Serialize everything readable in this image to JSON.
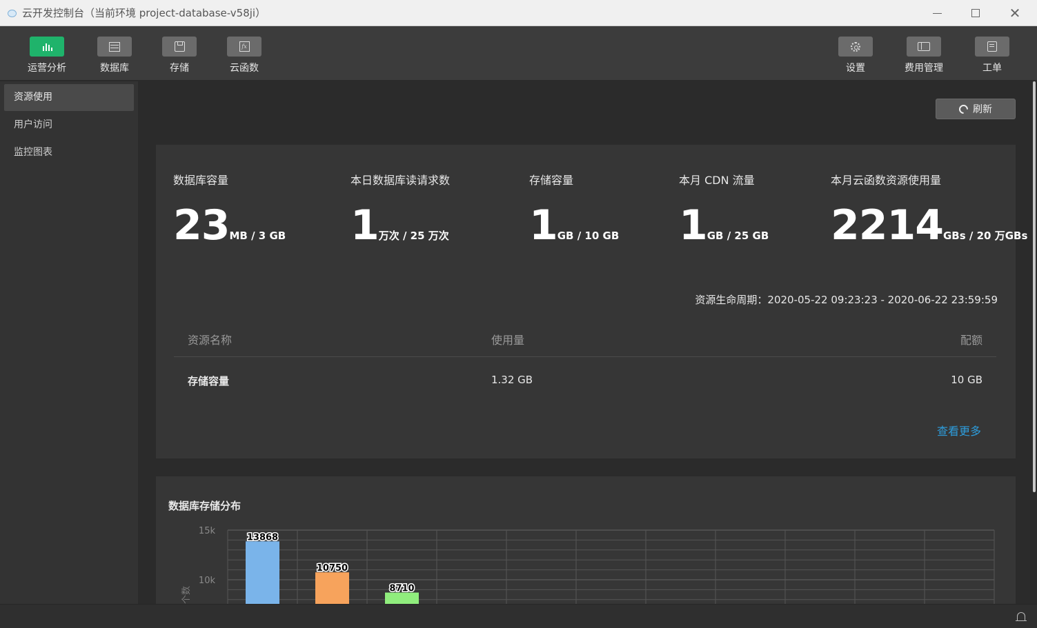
{
  "window": {
    "title": "云开发控制台（当前环境 project-database-v58ji）"
  },
  "toolbar": {
    "left": [
      {
        "label": "运营分析",
        "icon": "bar-chart-icon"
      },
      {
        "label": "数据库",
        "icon": "database-icon"
      },
      {
        "label": "存储",
        "icon": "storage-icon"
      },
      {
        "label": "云函数",
        "icon": "function-icon"
      }
    ],
    "right": [
      {
        "label": "设置",
        "icon": "gear-icon"
      },
      {
        "label": "费用管理",
        "icon": "billing-icon"
      },
      {
        "label": "工单",
        "icon": "ticket-icon"
      }
    ],
    "accent": "#1fb36b"
  },
  "sidebar": {
    "items": [
      {
        "label": "资源使用"
      },
      {
        "label": "用户访问"
      },
      {
        "label": "监控图表"
      }
    ]
  },
  "refresh_label": "刷新",
  "metrics": [
    {
      "label": "数据库容量",
      "value": "23",
      "unit": "MB / 3 GB"
    },
    {
      "label": "本日数据库读请求数",
      "value": "1",
      "unit": "万次 / 25 万次"
    },
    {
      "label": "存储容量",
      "value": "1",
      "unit": "GB / 10 GB"
    },
    {
      "label": "本月 CDN 流量",
      "value": "1",
      "unit": "GB / 25 GB"
    },
    {
      "label": "本月云函数资源使用量",
      "value": "2214",
      "unit": "GBs / 20 万GBs"
    }
  ],
  "lifecycle": "资源生命周期：2020-05-22 09:23:23 - 2020-06-22 23:59:59",
  "table": {
    "headers": [
      "资源名称",
      "使用量",
      "配额"
    ],
    "rows": [
      [
        "存储容量",
        "1.32 GB",
        "10 GB"
      ]
    ]
  },
  "more_label": "查看更多",
  "chart_title": "数据库存储分布",
  "chart_data": {
    "type": "bar",
    "title": "数据库存储分布",
    "ylabel": "个数",
    "y_ticks": [
      "15k",
      "10k"
    ],
    "ylim": [
      0,
      15000
    ],
    "values": [
      13868,
      10750,
      8710
    ],
    "colors": [
      "#7ab4ea",
      "#f7a35c",
      "#90ed7d"
    ],
    "grid": true
  }
}
